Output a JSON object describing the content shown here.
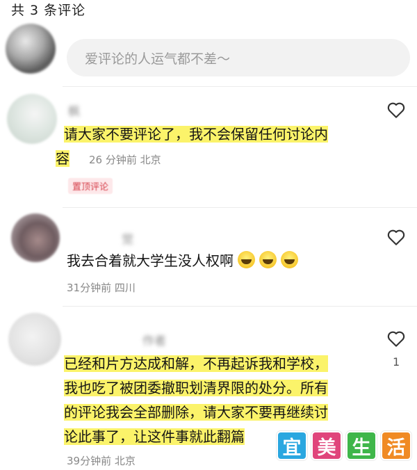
{
  "header": {
    "count_title": "共 3 条评论"
  },
  "input": {
    "placeholder": "爱评论的人运气都不差～"
  },
  "comments": [
    {
      "author": "枫",
      "text_line1": "请大家不要评论了，我不会保留任何讨论内",
      "text_line2": "容",
      "meta": "26 分钟前 北京",
      "badge": "置顶评论"
    },
    {
      "author": "觉",
      "text": "我去合着就大学生没人权啊",
      "meta": "31分钟前 四川"
    },
    {
      "author": "作者",
      "text_line1": "已经和片方达成和解，不再起诉我和学校，",
      "text_line2": "我也吃了被团委撤职划清界限的处分。所有",
      "text_line3": "的评论我会全部删除，请大家不要再继续讨",
      "text_line4": "论此事了，让这件事就此翻篇",
      "meta": "39分钟前 北京",
      "like_count": "1"
    }
  ],
  "watermark": {
    "chars": [
      "宜",
      "美",
      "生",
      "活"
    ],
    "colors": [
      "#2aa7e0",
      "#e0457b",
      "#3fb64a",
      "#f08a24"
    ]
  },
  "colors": {
    "highlight": "#fbf36a",
    "badge_text": "#d6404b",
    "input_bg": "#f2f2f2"
  }
}
